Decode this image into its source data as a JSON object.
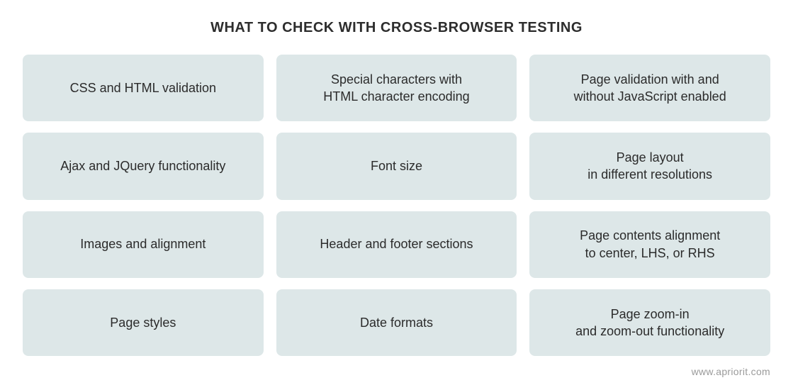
{
  "title": "WHAT TO CHECK WITH CROSS-BROWSER TESTING",
  "cards": [
    "CSS and HTML validation",
    "Special characters with\nHTML character encoding",
    "Page validation with and\nwithout JavaScript enabled",
    "Ajax and JQuery functionality",
    "Font size",
    "Page layout\nin different resolutions",
    "Images and alignment",
    "Header and footer sections",
    "Page contents alignment\nto center, LHS, or RHS",
    "Page styles",
    "Date formats",
    "Page zoom-in\nand zoom-out functionality"
  ],
  "footer": "www.apriorit.com"
}
